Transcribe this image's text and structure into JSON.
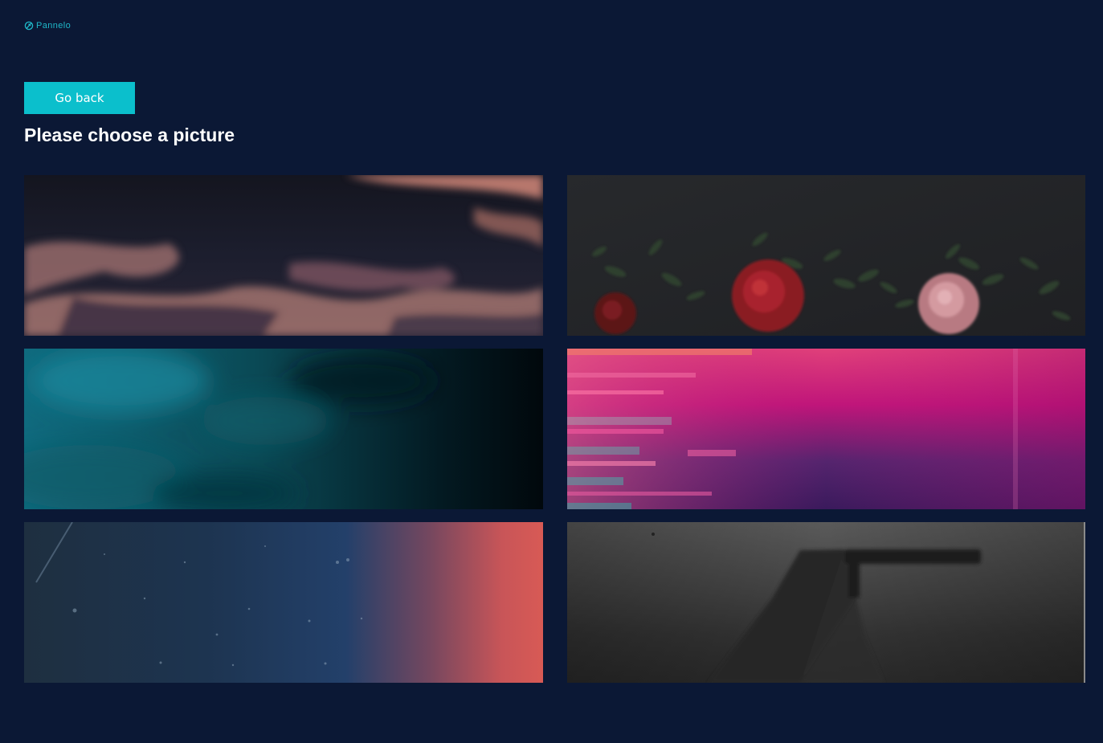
{
  "brand": {
    "name": "Pannelo",
    "icon": "pannelo-logo-icon",
    "color": "#1fb8c9"
  },
  "actions": {
    "go_back_label": "Go back"
  },
  "page": {
    "title": "Please choose a picture",
    "background": "#0b1835",
    "accent": "#0bbfcc"
  },
  "pictures": [
    {
      "subject": "sunset-ocean-waves"
    },
    {
      "subject": "roses-on-concrete"
    },
    {
      "subject": "teal-underwater-smoke"
    },
    {
      "subject": "pink-purple-glitch"
    },
    {
      "subject": "space-gradient-sunset"
    },
    {
      "subject": "foggy-pier-monochrome"
    }
  ]
}
